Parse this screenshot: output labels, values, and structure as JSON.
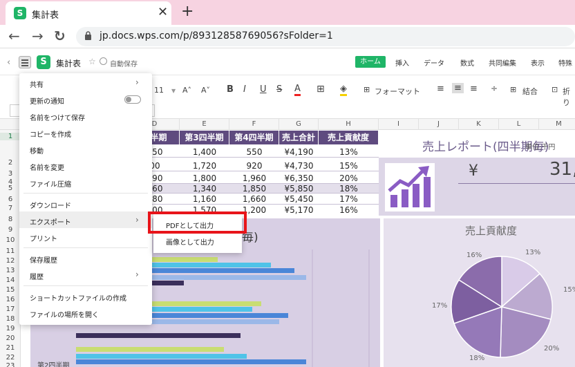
{
  "browser": {
    "tab_title": "集計表",
    "tab_icon": "S",
    "close": "✕",
    "new_tab": "+",
    "back": "←",
    "forward": "→",
    "reload": "↻",
    "url": "jp.docs.wps.com/p/89312858769056?sFolder=1"
  },
  "app": {
    "logo": "S",
    "doc_title": "集計表",
    "star": "☆",
    "autosave": "自動保存",
    "menu_tabs": [
      "ホーム",
      "挿入",
      "データ",
      "数式",
      "共同編集",
      "表示",
      "特殊"
    ],
    "active_tab": "ホーム"
  },
  "toolbar": {
    "font_size": "11",
    "size_up": "A˄",
    "size_down": "A˅",
    "bold": "B",
    "italic": "I",
    "underline": "U",
    "strike": "S",
    "font_color": "A",
    "border": "⊞",
    "fill": "◈",
    "format_label": "フォーマット",
    "merge_label": "結合",
    "wrap_label": "折り"
  },
  "grid": {
    "columns": [
      "D",
      "E",
      "F",
      "G",
      "H",
      "I",
      "J",
      "K",
      "L",
      "M"
    ],
    "rows": [
      "1",
      "2",
      "3",
      "4",
      "5",
      "6",
      "7",
      "8",
      "9",
      "10",
      "11",
      "12",
      "13",
      "14",
      "15",
      "16",
      "17",
      "18",
      "19",
      "20",
      "21",
      "22",
      "23"
    ]
  },
  "table": {
    "headers": [
      "四半期",
      "第3四半期",
      "第4四半期",
      "売上合計",
      "売上貢献度"
    ],
    "rows": [
      [
        "350",
        "1,400",
        "550",
        "¥4,190",
        "13%"
      ],
      [
        "00",
        "1,720",
        "920",
        "¥4,730",
        "15%"
      ],
      [
        "590",
        "1,800",
        "1,960",
        "¥6,350",
        "20%"
      ],
      [
        "960",
        "1,340",
        "1,850",
        "¥5,850",
        "18%"
      ],
      [
        "380",
        "1,160",
        "1,660",
        "¥5,450",
        "17%"
      ],
      [
        "000",
        "1,570",
        "1,200",
        "¥5,170",
        "16%"
      ]
    ]
  },
  "kpi": {
    "title": "売上レポート(四半期毎)",
    "unit": "単位:千円",
    "currency": "¥",
    "value": "31,"
  },
  "bar_chart": {
    "title_fragment": "毎)",
    "axis_label_fragment": "第2四半期",
    "colors": [
      "#c9dd72",
      "#4fc3e8",
      "#4a86d8",
      "#9bb8e8",
      "#3b2f5b"
    ]
  },
  "pie_chart": {
    "title": "売上貢献度",
    "labels": [
      "16%",
      "13%",
      "15%",
      "20%",
      "18%",
      "17%"
    ],
    "colors": [
      "#8b6cab",
      "#d9cbe8",
      "#bcaad0",
      "#a48cc0",
      "#a48cc0",
      "#7d5fa0"
    ]
  },
  "file_menu": {
    "items": [
      {
        "label": "共有",
        "arrow": "›"
      },
      {
        "label": "更新の通知"
      },
      {
        "label": "名前をつけて保存"
      },
      {
        "label": "コピーを作成"
      },
      {
        "label": "移動"
      },
      {
        "label": "名前を変更"
      },
      {
        "label": "ファイル圧縮"
      },
      {
        "label": "ダウンロード"
      },
      {
        "label": "エクスポート",
        "arrow": "›"
      },
      {
        "label": "プリント"
      },
      {
        "label": "保存履歴"
      },
      {
        "label": "履歴",
        "arrow": "›"
      },
      {
        "label": "ショートカットファイルの作成"
      },
      {
        "label": "ファイルの場所を開く"
      }
    ]
  },
  "export_submenu": {
    "items": [
      "PDFとして出力",
      "画像として出力"
    ]
  },
  "highlight_color": "#e8141a"
}
